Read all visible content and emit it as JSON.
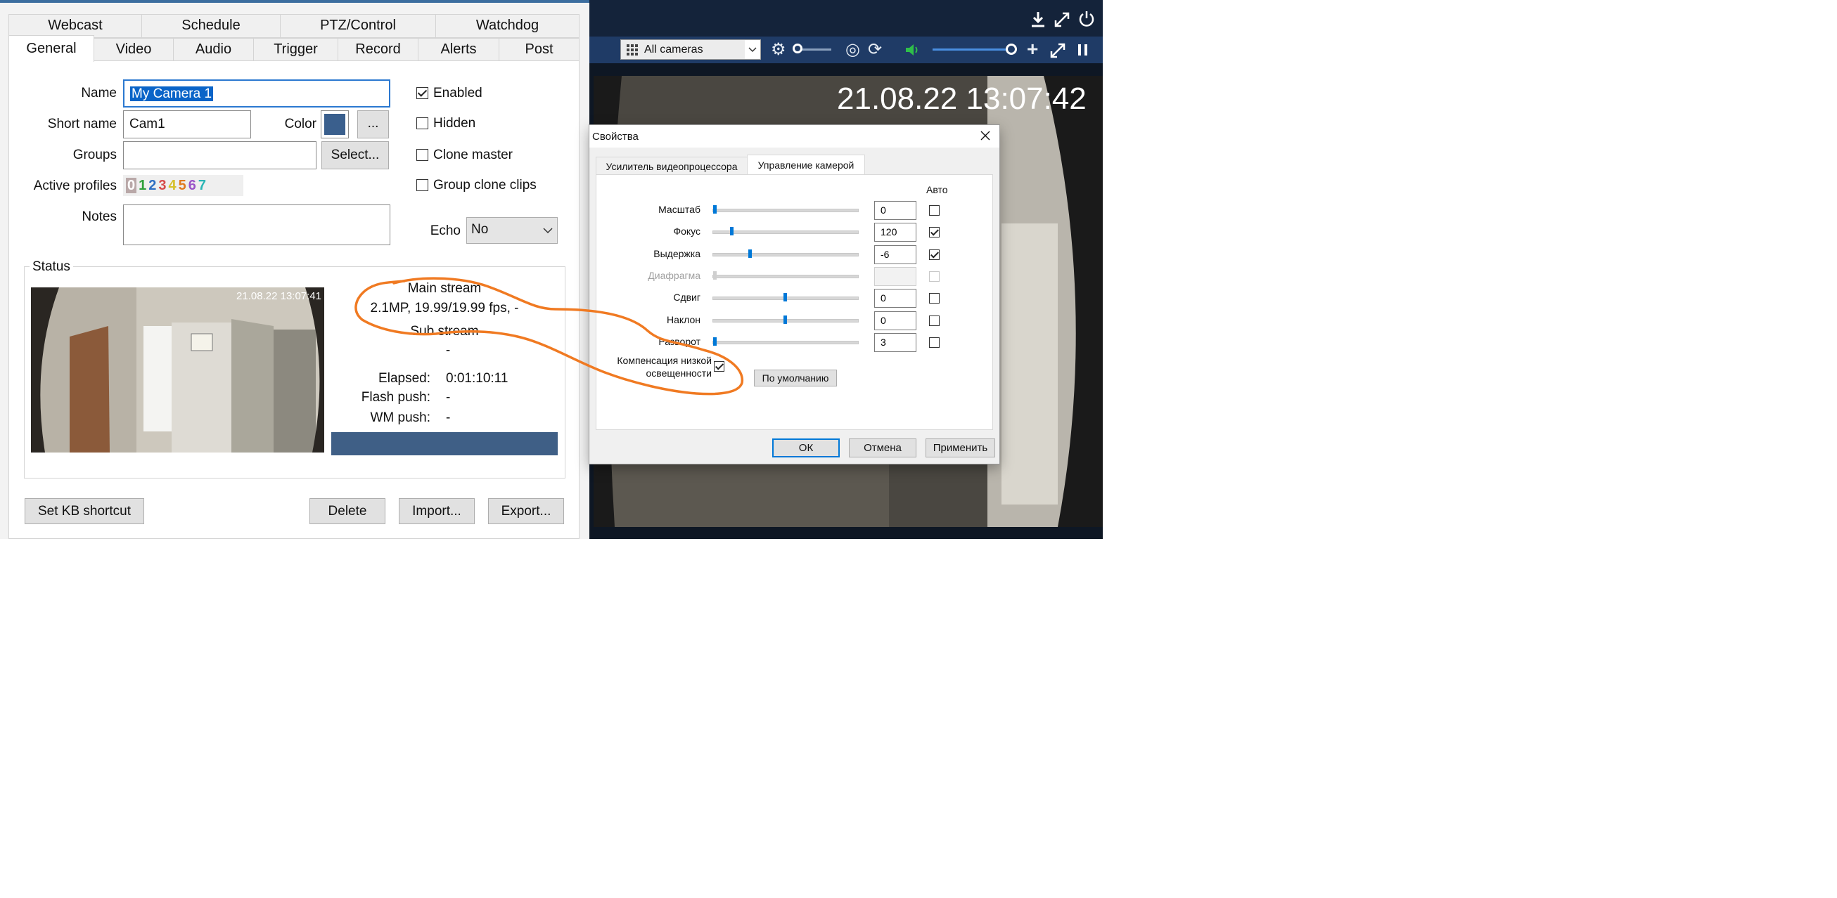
{
  "camera_settings": {
    "tabs_row1": [
      "Webcast",
      "Schedule",
      "PTZ/Control",
      "Watchdog"
    ],
    "tabs_row2": [
      "General",
      "Video",
      "Audio",
      "Trigger",
      "Record",
      "Alerts",
      "Post"
    ],
    "active_tab": "General",
    "form": {
      "name_label": "Name",
      "name_value": "My Camera 1",
      "short_name_label": "Short name",
      "short_name_value": "Cam1",
      "color_label": "Color",
      "color_value": "#3a5f8d",
      "color_button": "...",
      "groups_label": "Groups",
      "groups_value": "",
      "select_button": "Select...",
      "active_profiles_label": "Active profiles",
      "profiles": [
        "0",
        "1",
        "2",
        "3",
        "4",
        "5",
        "6",
        "7"
      ],
      "profile_colors": [
        "#ffffff",
        "#2e9f3a",
        "#2f6fc3",
        "#d64b4b",
        "#d6c02b",
        "#e07a1f",
        "#9a55c8",
        "#2bb5b5"
      ],
      "notes_label": "Notes",
      "notes_value": "",
      "enabled_label": "Enabled",
      "enabled_checked": true,
      "hidden_label": "Hidden",
      "hidden_checked": false,
      "clone_master_label": "Clone master",
      "clone_master_checked": false,
      "group_clone_label": "Group clone clips",
      "group_clone_checked": false,
      "echo_label": "Echo",
      "echo_value": "No"
    },
    "status": {
      "title": "Status",
      "preview_timestamp": "21.08.22 13:07:41",
      "main_stream_label": "Main stream",
      "main_stream_value": "2.1MP, 19.99/19.99 fps, -",
      "sub_stream_label": "Sub stream",
      "sub_stream_value": "-",
      "elapsed_label": "Elapsed:",
      "elapsed_value": "0:01:10:11",
      "flash_push_label": "Flash push:",
      "flash_push_value": "-",
      "wm_push_label": "WM push:",
      "wm_push_value": "-"
    },
    "buttons": {
      "set_kb_shortcut": "Set KB shortcut",
      "delete": "Delete",
      "import": "Import...",
      "export": "Export..."
    }
  },
  "viewer": {
    "camera_select": "All cameras",
    "osd_timestamp": "21.08.22 13:07:42",
    "volume_percent": 100
  },
  "properties_dialog": {
    "title": "Свойства",
    "tabs": [
      "Усилитель видеопроцессора",
      "Управление камерой"
    ],
    "active_tab": "Управление камерой",
    "auto_header": "Авто",
    "rows": [
      {
        "label": "Масштаб",
        "value": "0",
        "auto": false,
        "disabled": false
      },
      {
        "label": "Фокус",
        "value": "120",
        "auto": true,
        "disabled": false
      },
      {
        "label": "Выдержка",
        "value": "-6",
        "auto": true,
        "disabled": false
      },
      {
        "label": "Диафрагма",
        "value": "",
        "auto": false,
        "disabled": true
      },
      {
        "label": "Сдвиг",
        "value": "0",
        "auto": false,
        "disabled": false
      },
      {
        "label": "Наклон",
        "value": "0",
        "auto": false,
        "disabled": false
      },
      {
        "label": "Разворот",
        "value": "3",
        "auto": false,
        "disabled": false
      }
    ],
    "slider_positions": [
      0.0,
      0.12,
      0.25,
      0.0,
      0.5,
      0.5,
      0.0
    ],
    "low_light_label_line1": "Компенсация низкой",
    "low_light_label_line2": "освещенности",
    "low_light_checked": true,
    "default_button": "По умолчанию",
    "ok_button": "ОК",
    "cancel_button": "Отмена",
    "apply_button": "Применить"
  },
  "annotation_color": "#f07a22"
}
